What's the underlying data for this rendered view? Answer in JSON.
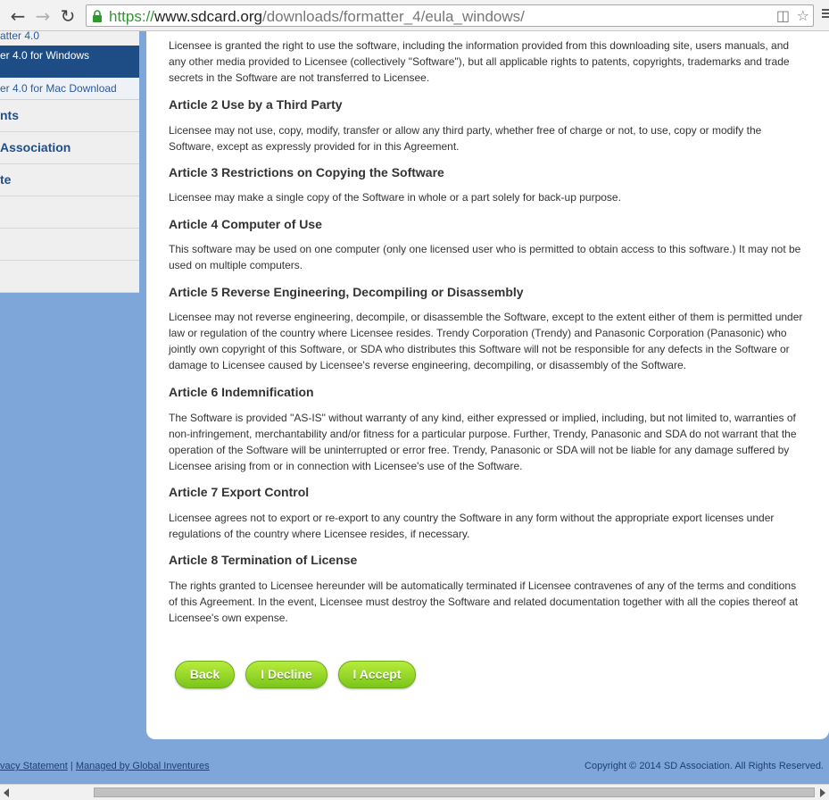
{
  "browser": {
    "url_scheme": "https://",
    "url_host": "www.sdcard.org",
    "url_path": "/downloads/formatter_4/eula_windows/",
    "back_icon": "arrow-left",
    "forward_icon": "arrow-right",
    "reload_icon": "reload",
    "lock_icon": "lock",
    "translate_icon": "translate",
    "bookmark_icon": "star",
    "menu_icon": "menu"
  },
  "sidebar": {
    "top_label": "atter 4.0",
    "active_label": "er 4.0 for Windows",
    "sub_label": "er 4.0 for Mac Download",
    "items": [
      {
        "label": "nts"
      },
      {
        "label": "Association"
      },
      {
        "label": "te"
      },
      {
        "label": ""
      },
      {
        "label": ""
      },
      {
        "label": ""
      }
    ]
  },
  "eula": {
    "intro": "Licensee is granted the right to use the software, including the information provided from this downloading site, users manuals, and any other media provided to Licensee (collectively \"Software\"), but all applicable rights to patents, copyrights, trademarks and trade secrets in the Software are not transferred to Licensee.",
    "articles": [
      {
        "title": "Article 2 Use by a Third Party",
        "body": "Licensee may not use, copy, modify, transfer or allow any third party, whether free of charge or not, to use, copy or modify the Software, except as expressly provided for in this Agreement."
      },
      {
        "title": "Article 3 Restrictions on Copying the Software",
        "body": "Licensee may make a single copy of the Software in whole or a part solely for back-up purpose."
      },
      {
        "title": "Article 4 Computer of Use",
        "body": "This software may be used on one computer (only one licensed user who is permitted to obtain access to this software.) It may not be used on multiple computers."
      },
      {
        "title": "Article 5 Reverse Engineering, Decompiling or Disassembly",
        "body": "Licensee may not reverse engineering, decompile, or disassemble the Software, except to the extent either of them is permitted under law or regulation of the country where Licensee resides. Trendy Corporation (Trendy) and Panasonic Corporation (Panasonic) who jointly own copyright of this Software, or SDA who distributes this Software will not be responsible for any defects in the Software or damage to Licensee caused by Licensee's reverse engineering, decompiling, or disassembly of the Software."
      },
      {
        "title": "Article 6 Indemnification",
        "body": "The Software is provided \"AS-IS\" without warranty of any kind, either expressed or implied, including, but not limited to, warranties of non-infringement, merchantability and/or fitness for a particular purpose. Further, Trendy, Panasonic and SDA do not warrant that the operation of the Software will be uninterrupted or error free. Trendy, Panasonic or SDA will not be liable for any damage suffered by Licensee arising from or in connection with Licensee's use of the Software."
      },
      {
        "title": "Article 7 Export Control",
        "body": "Licensee agrees not to export or re-export to any country the Software in any form without the appropriate export licenses under regulations of the country where Licensee resides, if necessary."
      },
      {
        "title": "Article 8 Termination of License",
        "body": "The rights granted to Licensee hereunder will be automatically terminated if Licensee contravenes of any of the terms and conditions of this Agreement. In the event, Licensee must destroy the Software and related documentation together with all the copies thereof at Licensee's own expense."
      }
    ]
  },
  "buttons": {
    "back": "Back",
    "decline": "I Decline",
    "accept": "I Accept"
  },
  "footer": {
    "privacy": "vacy Statement",
    "separator": "|",
    "managed": "Managed by Global Inventures",
    "copyright": "Copyright © 2014 SD Association. All Rights Reserved."
  },
  "colors": {
    "accent_green": "#7cc51a",
    "sidebar_active": "#1e4d86",
    "page_background": "#7fa6d9"
  }
}
